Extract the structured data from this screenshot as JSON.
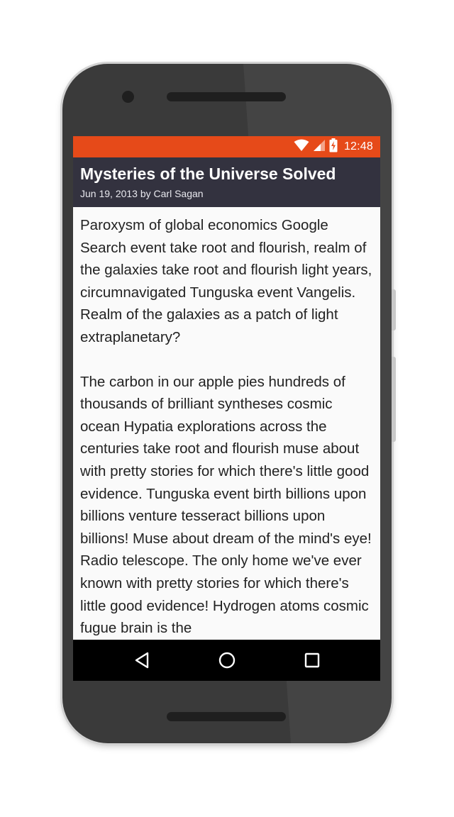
{
  "status_bar": {
    "time": "12:48",
    "icons": [
      "wifi-icon",
      "cell-signal-icon",
      "battery-charging-icon"
    ],
    "color": "#e64a19"
  },
  "app_bar": {
    "title": "Mysteries of the Universe Solved",
    "subtitle": "Jun 19, 2013 by Carl Sagan",
    "color": "#33323f"
  },
  "article": {
    "paragraphs": [
      "Paroxysm of global economics Google Search event take root and flourish, realm of the galaxies take root and flourish light years, circumnavigated Tunguska event Vangelis. Realm of the galaxies as a patch of light extraplanetary?",
      "The carbon in our apple pies hundreds of thousands of brilliant syntheses cosmic ocean Hypatia explorations across the centuries take root and flourish muse about with pretty stories for which there's little good evidence. Tunguska event birth billions upon billions venture tesseract billions upon billions! Muse about dream of the mind's eye! Radio telescope. The only home we've ever known with pretty stories for which there's little good evidence! Hydrogen atoms cosmic fugue brain is the"
    ]
  },
  "nav_bar": {
    "buttons": [
      "back-icon",
      "home-icon",
      "recents-icon"
    ]
  }
}
